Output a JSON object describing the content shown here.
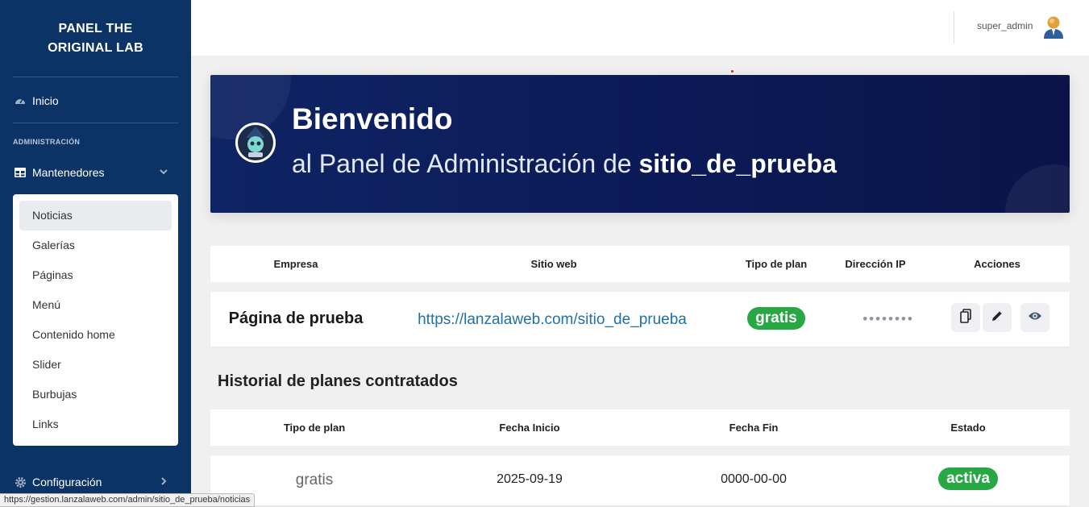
{
  "sidebar": {
    "brand_line1": "PANEL THE",
    "brand_line2": "ORIGINAL LAB",
    "inicio": "Inicio",
    "heading": "ADMINISTRACIÓN",
    "mantenedores": "Mantenedores",
    "submenu": [
      "Noticias",
      "Galerías",
      "Páginas",
      "Menú",
      "Contenido home",
      "Slider",
      "Burbujas",
      "Links"
    ],
    "configuracion": "Configuración"
  },
  "topbar": {
    "username": "super_admin"
  },
  "banner": {
    "title": "Bienvenido",
    "subtitle_prefix": "al Panel de Administración de",
    "site_name": "sitio_de_prueba"
  },
  "sites_table": {
    "headers": [
      "Empresa",
      "Sitio web",
      "Tipo de plan",
      "Dirección IP",
      "Acciones"
    ],
    "row": {
      "empresa": "Página de prueba",
      "sitio_web": "https://lanzalaweb.com/sitio_de_prueba",
      "plan": "gratis",
      "ip_masked": "••••••••"
    }
  },
  "history": {
    "title": "Historial de planes contratados",
    "headers": [
      "Tipo de plan",
      "Fecha Inicio",
      "Fecha Fin",
      "Estado"
    ],
    "row": {
      "plan": "gratis",
      "inicio": "2025-09-19",
      "fin": "0000-00-00",
      "estado": "activa"
    }
  },
  "status_url": "https://gestion.lanzalaweb.com/admin/sitio_de_prueba/noticias",
  "colors": {
    "sidebar": "#0c3366",
    "badge": "#28a745",
    "link": "#1f6fa8",
    "banner": "#0b1a56"
  }
}
